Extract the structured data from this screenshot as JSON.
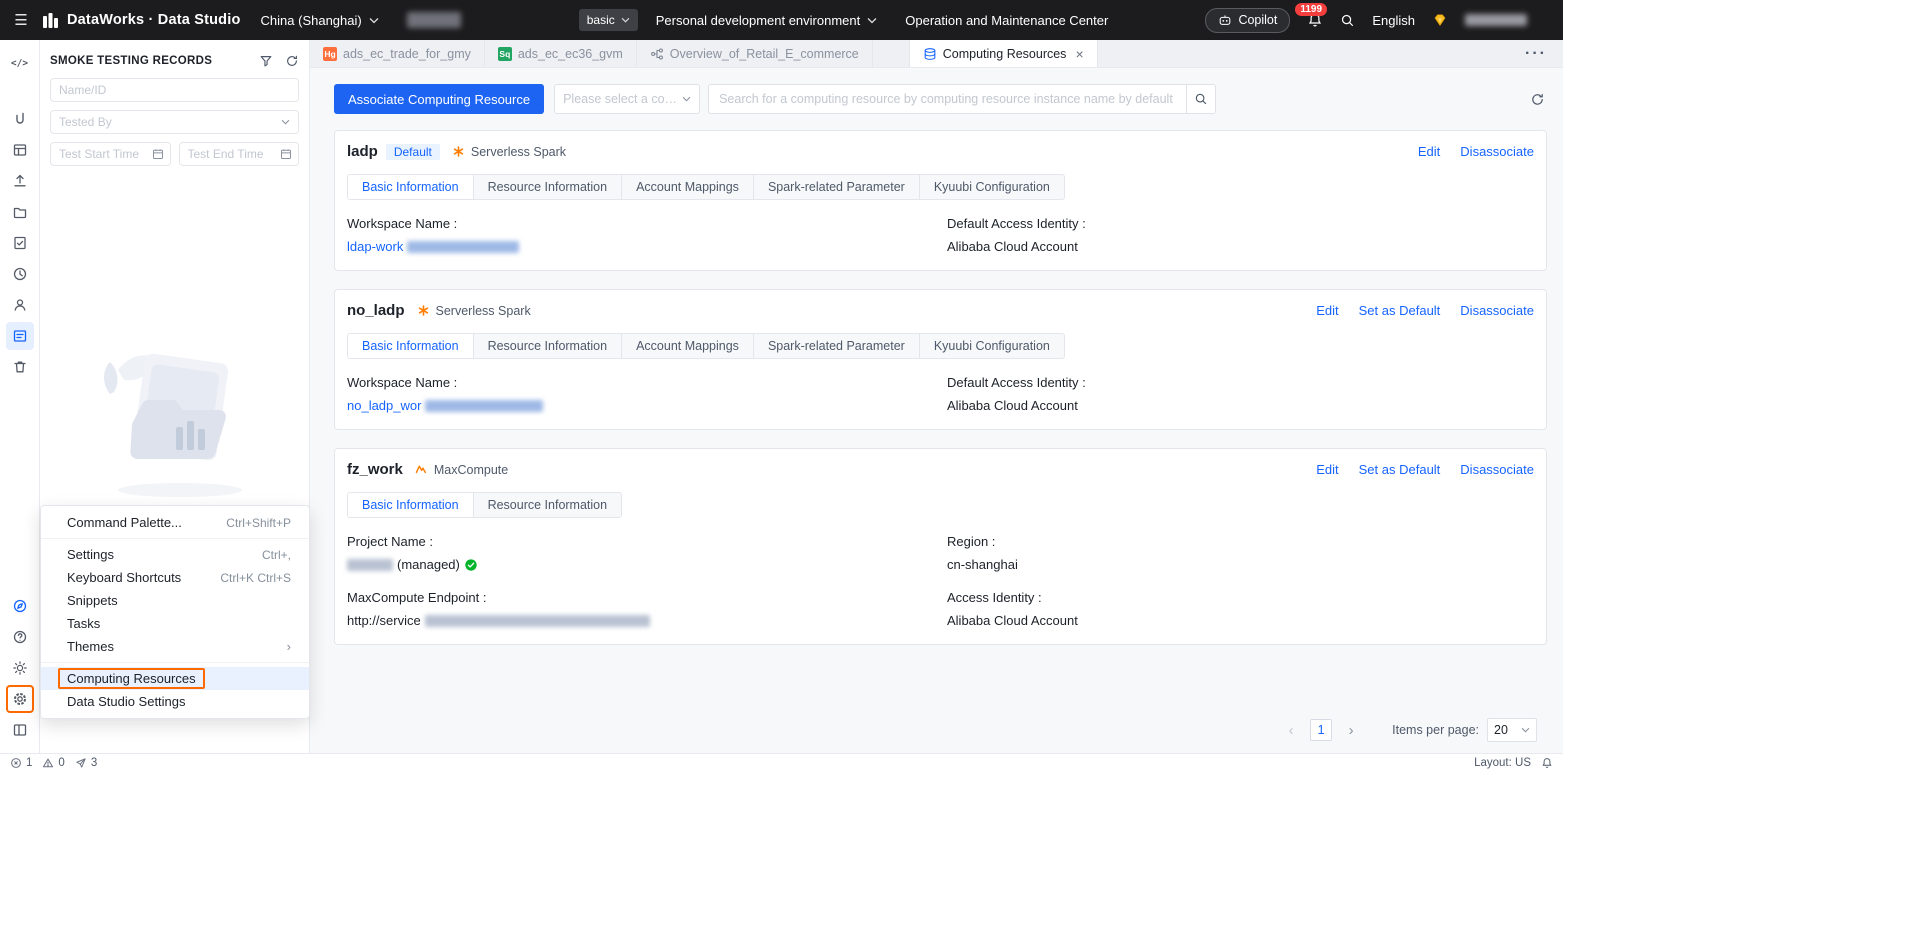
{
  "topbar": {
    "product": "DataWorks · Data Studio",
    "region": "China (Shanghai)",
    "mode_select": "basic",
    "env_select": "Personal development environment",
    "nav_center": "Operation and Maintenance Center",
    "copilot_label": "Copilot",
    "notification_count": "1199",
    "language": "English"
  },
  "sidebar_rail": {
    "top_icons": [
      "code-icon",
      "integration-icon",
      "table-icon",
      "publish-icon",
      "folder-icon",
      "checklist-icon",
      "history-icon",
      "user-icon",
      "resources-icon",
      "trash-icon"
    ],
    "active_icon": "resources-icon",
    "bottom_icons": [
      "compass-icon",
      "help-icon",
      "theme-icon",
      "settings-gear-icon",
      "layout-icon"
    ]
  },
  "panel": {
    "title": "SMOKE TESTING RECORDS",
    "filters": {
      "name_placeholder": "Name/ID",
      "tested_by_placeholder": "Tested By",
      "start_time_placeholder": "Test Start Time",
      "end_time_placeholder": "Test End Time"
    }
  },
  "settings_menu": {
    "items": [
      {
        "label": "Command Palette...",
        "shortcut": "Ctrl+Shift+P"
      },
      {
        "label": "Settings",
        "shortcut": "Ctrl+,"
      },
      {
        "label": "Keyboard Shortcuts",
        "shortcut": "Ctrl+K Ctrl+S"
      },
      {
        "label": "Snippets",
        "shortcut": ""
      },
      {
        "label": "Tasks",
        "shortcut": ""
      },
      {
        "label": "Themes",
        "shortcut": ""
      },
      {
        "label": "Computing Resources",
        "shortcut": ""
      },
      {
        "label": "Data Studio Settings",
        "shortcut": ""
      }
    ]
  },
  "editor_tabs": {
    "tabs": [
      {
        "label": "ads_ec_trade_for_gmy",
        "badge": "Hg"
      },
      {
        "label": "ads_ec_ec36_gvm",
        "badge": "Sq"
      },
      {
        "label": "Overview_of_Retail_E_commerce",
        "badge": ""
      },
      {
        "label": "Computing Resources",
        "badge": "",
        "active": true
      }
    ]
  },
  "toolbar": {
    "associate_button": "Associate Computing Resource",
    "type_select_placeholder": "Please select a comput",
    "search_placeholder": "Search for a computing resource by computing resource instance name by default"
  },
  "cards": [
    {
      "title": "ladp",
      "badge": "Default",
      "engine": "Serverless Spark",
      "actions": {
        "edit": "Edit",
        "disassociate": "Disassociate"
      },
      "tabs": [
        "Basic Information",
        "Resource Information",
        "Account Mappings",
        "Spark-related Parameter",
        "Kyuubi Configuration"
      ],
      "active_tab": "Basic Information",
      "fields": {
        "col1_label": "Workspace Name :",
        "col1_value": "ldap-work",
        "col2_label": "Default Access Identity :",
        "col2_value": "Alibaba Cloud Account"
      }
    },
    {
      "title": "no_ladp",
      "engine": "Serverless Spark",
      "actions": {
        "edit": "Edit",
        "set_default": "Set as Default",
        "disassociate": "Disassociate"
      },
      "tabs": [
        "Basic Information",
        "Resource Information",
        "Account Mappings",
        "Spark-related Parameter",
        "Kyuubi Configuration"
      ],
      "active_tab": "Basic Information",
      "fields": {
        "col1_label": "Workspace Name :",
        "col1_value": "no_ladp_wor",
        "col2_label": "Default Access Identity :",
        "col2_value": "Alibaba Cloud Account"
      }
    },
    {
      "title": "fz_work",
      "engine": "MaxCompute",
      "actions": {
        "edit": "Edit",
        "set_default": "Set as Default",
        "disassociate": "Disassociate"
      },
      "tabs": [
        "Basic Information",
        "Resource Information"
      ],
      "active_tab": "Basic Information",
      "fields": {
        "row1_col1_label": "Project Name :",
        "row1_col1_value": "(managed)",
        "row1_col2_label": "Region :",
        "row1_col2_value": "cn-shanghai",
        "row2_col1_label": "MaxCompute Endpoint :",
        "row2_col1_value": "http://service",
        "row2_col2_label": "Access Identity :",
        "row2_col2_value": "Alibaba Cloud Account"
      }
    }
  ],
  "pagination": {
    "current_page": "1",
    "items_per_page_label": "Items per page:",
    "page_size": "20"
  },
  "statusbar": {
    "errors": "1",
    "warnings": "0",
    "notices": "3",
    "layout_label": "Layout: US"
  },
  "colors": {
    "primary_blue": "#1664ff",
    "highlight_orange": "#ff6a00",
    "badge_red": "#f53f3f",
    "spark_orange": "#ff7d00",
    "success_green": "#00b42a",
    "hologres_badge": "#ff6f3c",
    "sq_badge": "#22a462"
  }
}
